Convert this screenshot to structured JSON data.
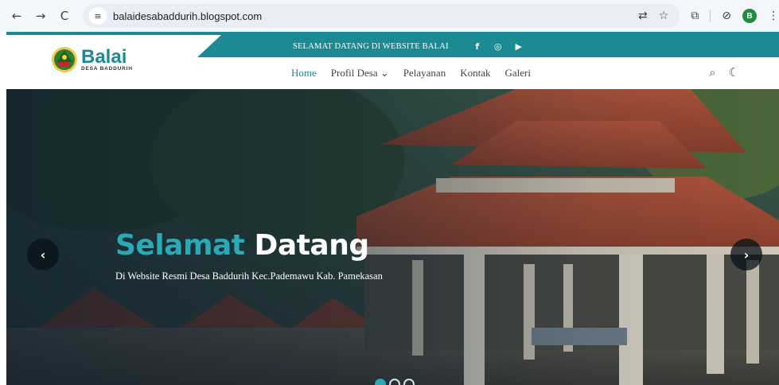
{
  "browser": {
    "back_icon": "←",
    "forward_icon": "→",
    "reload_icon": "C",
    "site_info_icon": "≡",
    "url": "balaidesabaddurih.blogspot.com",
    "translate_icon": "⇄",
    "bookmark_icon": "☆",
    "extensions_icon": "⧉",
    "extension2_icon": "⊘",
    "profile_initial": "B",
    "menu_icon": "⋮"
  },
  "site": {
    "topbar": {
      "welcome": "SELAMAT DATANG DI WEBSITE BALAI",
      "socials": [
        "f",
        "◎",
        "▶"
      ]
    },
    "logo": {
      "title": "Balai",
      "subtitle": "DESA BADDURIH"
    },
    "nav": {
      "items": [
        {
          "label": "Home",
          "active": true
        },
        {
          "label": "Profil Desa ⌄",
          "active": false
        },
        {
          "label": "Pelayanan",
          "active": false
        },
        {
          "label": "Kontak",
          "active": false
        },
        {
          "label": "Galeri",
          "active": false
        }
      ],
      "search_icon": "⌕",
      "theme_icon": "☾"
    },
    "hero": {
      "title_accent": "Selamat",
      "title_rest": "Datang",
      "subtitle": "Di Website Resmi Desa Baddurih Kec.Pademawu Kab. Pamekasan",
      "prev_icon": "‹",
      "next_icon": "›",
      "slide_count": 3,
      "active_slide": 1
    },
    "colors": {
      "accent": "#1b8a93",
      "accent_light": "#2aa9b6"
    }
  }
}
